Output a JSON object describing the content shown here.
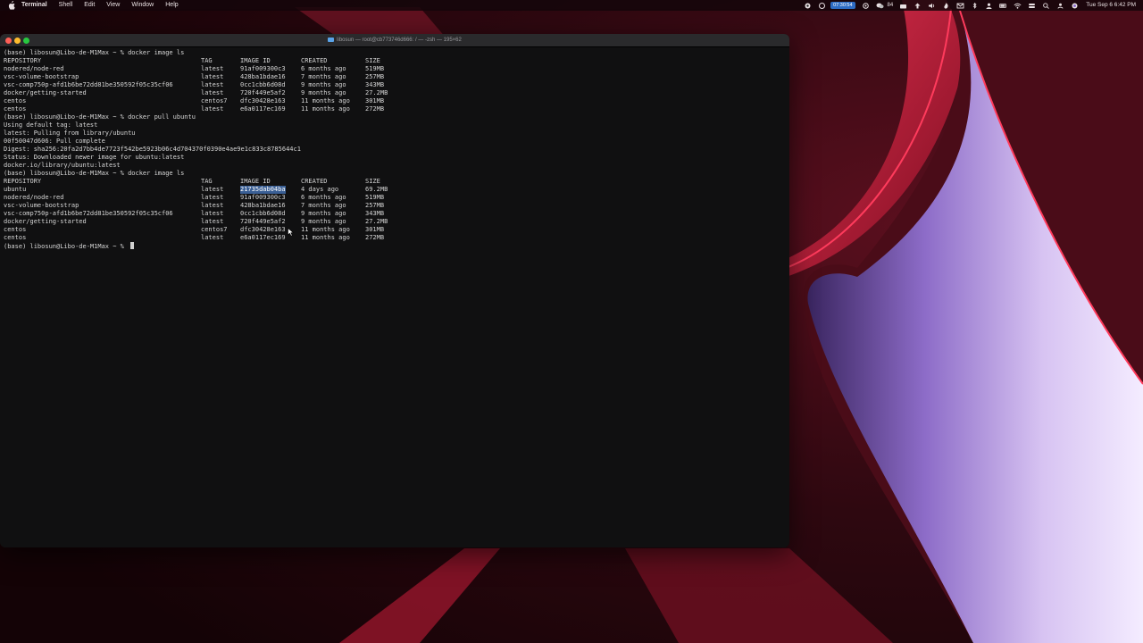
{
  "menubar": {
    "app_name": "Terminal",
    "menus": [
      "Shell",
      "Edit",
      "View",
      "Window",
      "Help"
    ],
    "recording_time": "07:30:54",
    "battery_percent": "84",
    "clock": "Tue Sep 6  6:42 PM"
  },
  "terminal": {
    "window_title": "libosun — root@cb773746d666: / — -zsh — 195×62",
    "prompt1": "(base) libosun@Libo-de-M1Max ~ % docker image ls",
    "headers": [
      "REPOSITORY",
      "TAG",
      "IMAGE ID",
      "CREATED",
      "SIZE"
    ],
    "table1": [
      [
        "nodered/node-red",
        "latest",
        "91af009300c3",
        "6 months ago",
        "519MB"
      ],
      [
        "vsc-volume-bootstrap",
        "latest",
        "428ba1bdae16",
        "7 months ago",
        "257MB"
      ],
      [
        "vsc-comp750p-afd1b6be72dd81be350592f05c35cf06",
        "latest",
        "0cc1cbb6d08d",
        "9 months ago",
        "343MB"
      ],
      [
        "docker/getting-started",
        "latest",
        "720f449e5af2",
        "9 months ago",
        "27.2MB"
      ],
      [
        "centos",
        "centos7",
        "dfc30428e163",
        "11 months ago",
        "301MB"
      ],
      [
        "centos",
        "latest",
        "e6a0117ec169",
        "11 months ago",
        "272MB"
      ]
    ],
    "prompt2": "(base) libosun@Libo-de-M1Max ~ % docker pull ubuntu",
    "pull_output": [
      "Using default tag: latest",
      "latest: Pulling from library/ubuntu",
      "00f50047d606: Pull complete",
      "Digest: sha256:20fa2d7bb4de7723f542be5923b06c4d704370f0390e4ae9e1c833c8785644c1",
      "Status: Downloaded newer image for ubuntu:latest",
      "docker.io/library/ubuntu:latest"
    ],
    "prompt3": "(base) libosun@Libo-de-M1Max ~ % docker image ls",
    "table2": [
      [
        "ubuntu",
        "latest",
        "21735dab04ba",
        "4 days ago",
        "69.2MB"
      ],
      [
        "nodered/node-red",
        "latest",
        "91af009300c3",
        "6 months ago",
        "519MB"
      ],
      [
        "vsc-volume-bootstrap",
        "latest",
        "428ba1bdae16",
        "7 months ago",
        "257MB"
      ],
      [
        "vsc-comp750p-afd1b6be72dd81be350592f05c35cf06",
        "latest",
        "0cc1cbb6d08d",
        "9 months ago",
        "343MB"
      ],
      [
        "docker/getting-started",
        "latest",
        "720f449e5af2",
        "9 months ago",
        "27.2MB"
      ],
      [
        "centos",
        "centos7",
        "dfc30428e163",
        "11 months ago",
        "301MB"
      ],
      [
        "centos",
        "latest",
        "e6a0117ec169",
        "11 months ago",
        "272MB"
      ]
    ],
    "prompt4": "(base) libosun@Libo-de-M1Max ~ % "
  },
  "colors": {
    "selection": "#3a5f95",
    "terminal_bg": "#101011",
    "wallpaper_accent": "#c0213e"
  },
  "icons": [
    "apple-logo-icon",
    "folder-icon",
    "mouse-pointer-icon"
  ]
}
